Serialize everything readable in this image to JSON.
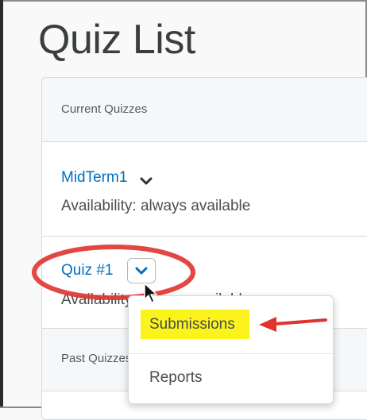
{
  "page": {
    "title": "Quiz List"
  },
  "current": {
    "header": "Current Quizzes",
    "quizzes": [
      {
        "name": "MidTerm1",
        "availability": "Availability: always available"
      },
      {
        "name": "Quiz #1",
        "availability": "Availability: always available"
      }
    ]
  },
  "past": {
    "header": "Past Quizzes"
  },
  "menu": {
    "items": [
      {
        "label": "Submissions",
        "highlighted": true
      },
      {
        "label": "Reports"
      }
    ]
  },
  "annotation": {
    "ellipse_color": "#e0332f",
    "arrow_color": "#e0332f",
    "highlight_color": "#fbf31c"
  },
  "icons": {
    "chevron": "chevron-down-icon",
    "cursor": "mouse-pointer-icon"
  }
}
